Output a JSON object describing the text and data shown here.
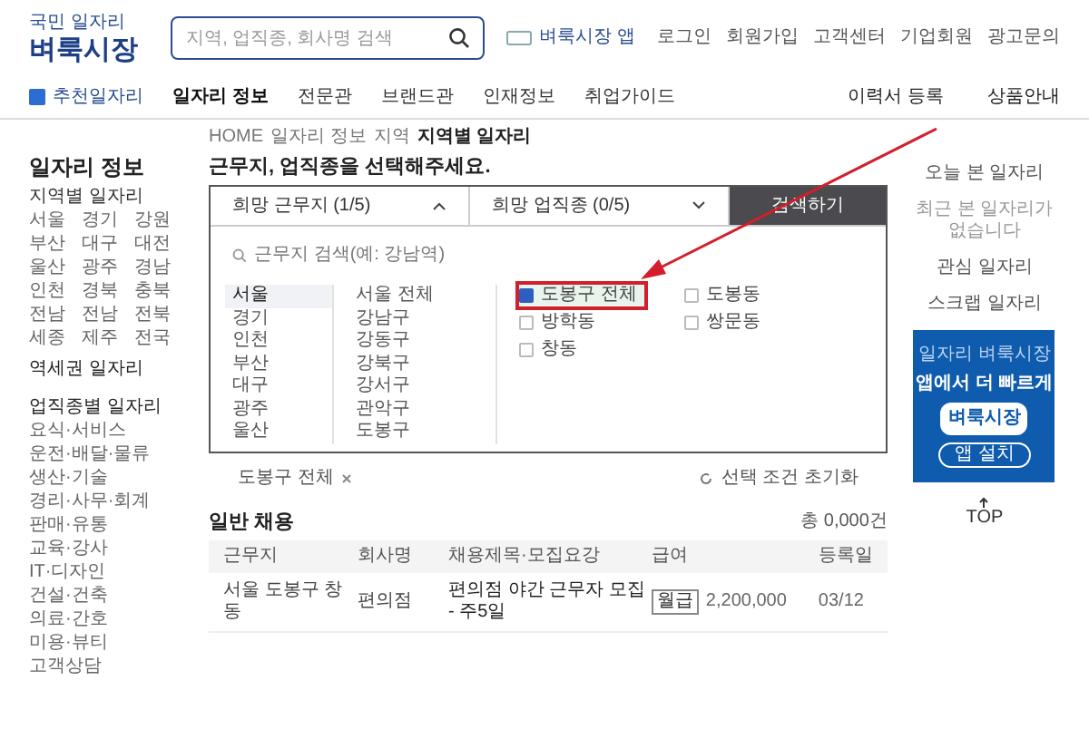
{
  "logo": {
    "tagline": "국민 일자리",
    "name": "벼룩시장"
  },
  "search": {
    "placeholder": "지역, 업직종, 회사명 검색"
  },
  "app_link": "벼룩시장 앱",
  "top_links": [
    "로그인",
    "회원가입",
    "고객센터",
    "기업회원",
    "광고문의"
  ],
  "nav": {
    "featured": "추천일자리",
    "items": [
      {
        "label": "일자리 정보",
        "selected": true
      },
      {
        "label": "전문관",
        "selected": false
      },
      {
        "label": "브랜드관",
        "selected": false
      },
      {
        "label": "인재정보",
        "selected": false
      },
      {
        "label": "취업가이드",
        "selected": false
      }
    ],
    "right": [
      "이력서 등록",
      "상품안내"
    ]
  },
  "sidebar": {
    "title": "일자리 정보",
    "region_heading": "지역별 일자리",
    "regions": [
      "서울",
      "경기",
      "강원",
      "부산",
      "대구",
      "대전",
      "울산",
      "광주",
      "경남",
      "인천",
      "경북",
      "충북",
      "전남",
      "전남",
      "전북",
      "세종",
      "제주",
      "전국"
    ],
    "station": "역세권 일자리",
    "job_heading": "업직종별 일자리",
    "jobs": [
      "요식·서비스",
      "운전·배달·물류",
      "생산·기술",
      "경리·사무·회계",
      "판매·유통",
      "교육·강사",
      "IT·디자인",
      "건설·건축",
      "의료·간호",
      "미용·뷰티",
      "고객상담"
    ]
  },
  "breadcrumb": [
    "HOME",
    "일자리 정보",
    "지역",
    "지역별 일자리"
  ],
  "heading": "근무지, 업직종을 선택해주세요.",
  "selector": {
    "tabs": [
      {
        "label": "희망 근무지 (1/5)",
        "expanded": true
      },
      {
        "label": "희망 업직종 (0/5)",
        "expanded": false
      }
    ],
    "search_button": "검색하기",
    "search_placeholder": "근무지 검색(예: 강남역)",
    "cities": [
      {
        "label": "서울",
        "selected": true
      },
      {
        "label": "경기",
        "selected": false
      },
      {
        "label": "인천",
        "selected": false
      },
      {
        "label": "부산",
        "selected": false
      },
      {
        "label": "대구",
        "selected": false
      },
      {
        "label": "광주",
        "selected": false
      },
      {
        "label": "울산",
        "selected": false
      }
    ],
    "districts": [
      "서울 전체",
      "강남구",
      "강동구",
      "강북구",
      "강서구",
      "관악구",
      "도봉구"
    ],
    "areas": [
      {
        "label": "도봉구 전체",
        "checked": true,
        "highlighted": true
      },
      {
        "label": "도봉동",
        "checked": false,
        "highlighted": false
      },
      {
        "label": "방학동",
        "checked": false,
        "highlighted": false
      },
      {
        "label": "쌍문동",
        "checked": false,
        "highlighted": false
      },
      {
        "label": "창동",
        "checked": false,
        "highlighted": false
      }
    ],
    "chosen": [
      "도봉구 전체"
    ],
    "reset": "선택 조건 초기화"
  },
  "listing": {
    "title": "일반 채용",
    "count": "총 0,000건",
    "columns": [
      "근무지",
      "회사명",
      "채용제목·모집요강",
      "급여",
      "등록일"
    ],
    "rows": [
      {
        "place": "서울 도봉구 창동",
        "company": "편의점",
        "title": "편의점 야간 근무자 모집 - 주5일",
        "pay_type": "월급",
        "pay": "2,200,000",
        "date": "03/12"
      }
    ]
  },
  "right_panel": {
    "links": [
      "오늘 본 일자리",
      "최근 본 일자리가 없습니다",
      "관심 일자리",
      "스크랩 일자리"
    ],
    "ad": {
      "top": "일자리 벼룩시장",
      "title": "앱에서 더 빠르게",
      "app": "벼룩시장",
      "button": "앱 설치"
    },
    "top": "TOP"
  }
}
